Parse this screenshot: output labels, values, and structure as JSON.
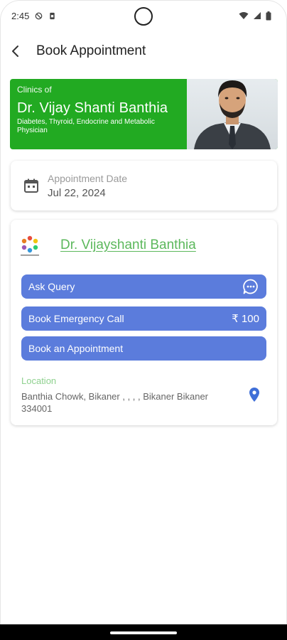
{
  "status_bar": {
    "time": "2:45",
    "icons": [
      "do-not-disturb-icon",
      "sim-icon",
      "wifi-icon",
      "signal-icon",
      "battery-icon"
    ]
  },
  "app_bar": {
    "back_icon": "chevron-left-icon",
    "title": "Book Appointment"
  },
  "banner": {
    "clinics_label": "Clinics of",
    "doctor_name": "Dr. Vijay Shanti  Banthia",
    "specialization": "Diabetes, Thyroid, Endocrine and Metabolic Physician",
    "background_color": "#22aa22"
  },
  "date_card": {
    "label": "Appointment Date",
    "value": "Jul 22, 2024",
    "icon": "calendar-icon"
  },
  "doctor_card": {
    "doctor_name": "Dr. Vijayshanti Banthia",
    "logo_icon": "clinic-logo-icon",
    "buttons": {
      "ask_query": "Ask Query",
      "emergency": "Book Emergency Call",
      "emergency_fee": "₹ 100",
      "appointment": "Book an Appointment"
    },
    "location_label": "Location",
    "location_value": "Banthia Chowk, Bikaner , , , , Bikaner Bikaner 334001",
    "location_icon": "map-pin-icon"
  },
  "colors": {
    "accent_blue": "#5b7cdc",
    "link_green": "#5cb85c",
    "location_label_green": "#8fd18f"
  }
}
